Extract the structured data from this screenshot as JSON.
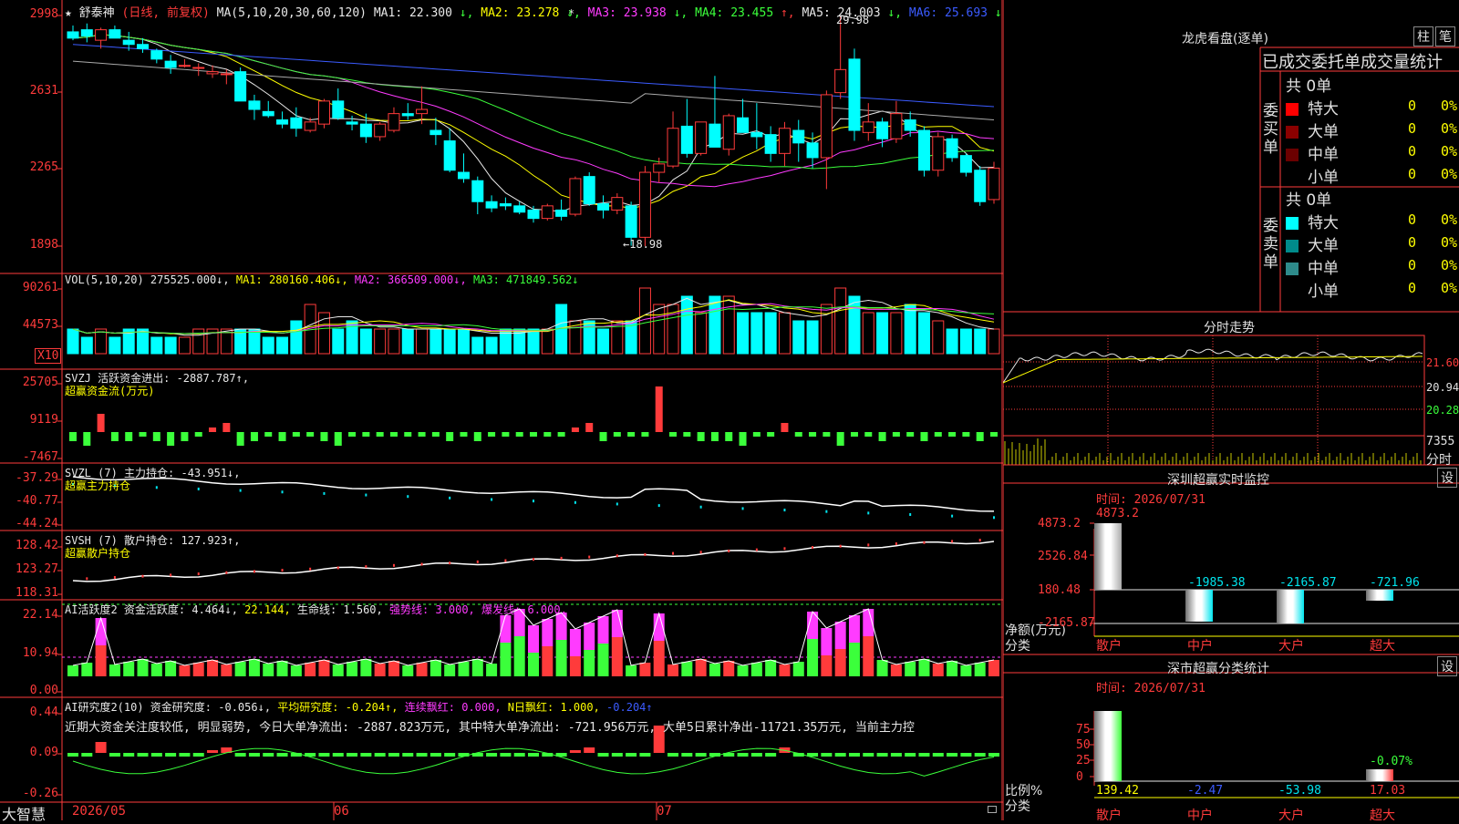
{
  "stock": {
    "star": "★",
    "name": "舒泰神",
    "mode": "(日线, 前复权)"
  },
  "ma_header": {
    "params": "MA(5,10,20,30,60,120)",
    "items": [
      {
        "label": "MA1:",
        "value": "22.300",
        "arrow": "↓",
        "color": "#e8e8e8"
      },
      {
        "label": "MA2:",
        "value": "23.278",
        "arrow": "↓",
        "color": "#ffff00"
      },
      {
        "label": "MA3:",
        "value": "23.938",
        "arrow": "↓",
        "color": "#ff3bff"
      },
      {
        "label": "MA4:",
        "value": "23.455",
        "arrow": "↑",
        "color": "#3bff3b"
      },
      {
        "label": "MA5:",
        "value": "24.003",
        "arrow": "↓",
        "color": "#e8e8e8"
      },
      {
        "label": "MA6:",
        "value": "25.693",
        "arrow": "↓",
        "color": "#3b5bff"
      }
    ],
    "high_label": "29.98",
    "low_label": "←18.98"
  },
  "price_axis": [
    "2998",
    "2631",
    "2265",
    "1898"
  ],
  "vol": {
    "header": [
      {
        "text": "VOL(5,10,20)",
        "color": "#e8e8e8"
      },
      {
        "text": "275525.000↓,",
        "color": "#e8e8e8"
      },
      {
        "text": "MA1: 280160.406↓,",
        "color": "#ffff00"
      },
      {
        "text": "MA2: 366509.000↓,",
        "color": "#ff3bff"
      },
      {
        "text": "MA3: 471849.562↓",
        "color": "#3bff3b"
      }
    ],
    "axis": [
      "90261",
      "44573"
    ],
    "unit": "X10"
  },
  "svzj": {
    "line1": "SVZJ  活跃资金进出: -2887.787↑,",
    "line2": "超赢资金流(万元)",
    "axis": [
      "25705",
      "9119",
      "-7467"
    ]
  },
  "svzl": {
    "line1": "SVZL (7) 主力持仓: -43.951↓,",
    "line2": "超赢主力持仓",
    "axis": [
      "-37.29",
      "-40.77",
      "-44.24"
    ]
  },
  "svsh": {
    "line1": "SVSH (7) 散户持仓: 127.923↑,",
    "line2": "超赢散户持仓",
    "axis": [
      "128.42",
      "123.27",
      "118.31"
    ]
  },
  "ai_active": {
    "header": [
      {
        "text": "AI活跃度2 资金活跃度: 4.464↓,",
        "color": "#e8e8e8"
      },
      {
        "text": "22.144,",
        "color": "#ffff00"
      },
      {
        "text": "生命线: 1.560,",
        "color": "#e8e8e8"
      },
      {
        "text": "强势线: 3.000,",
        "color": "#ff3bff"
      },
      {
        "text": "爆发线: 6.000,",
        "color": "#ff3bff"
      }
    ],
    "axis": [
      "22.14",
      "10.94",
      "0.00"
    ]
  },
  "ai_research": {
    "header": [
      {
        "text": "AI研究度2(10) 资金研究度: -0.056↓,",
        "color": "#e8e8e8"
      },
      {
        "text": "平均研究度: -0.204↑,",
        "color": "#ffff00"
      },
      {
        "text": "连续飘红: 0.000,",
        "color": "#ff3bff"
      },
      {
        "text": "N日飘红: 1.000,",
        "color": "#ffff00"
      },
      {
        "text": "-0.204↑",
        "color": "#3b5bff"
      }
    ],
    "comment": "近期大资金关注度较低, 明显弱势, 今日大单净流出: -2887.823万元, 其中特大单净流出: -721.956万元, 大单5日累计净出-11721.35万元, 当前主力控",
    "axis": [
      "0.44",
      "0.09",
      "-0.26"
    ]
  },
  "date_axis": {
    "logo": "大智慧",
    "labels": [
      "2026/05",
      "06",
      "07"
    ]
  },
  "right": {
    "lhb_title": "龙虎看盘(逐单)",
    "btn_bar": "柱",
    "btn_stroke": "笔",
    "stats_header": "已成交委托单成交量统计",
    "buy": {
      "vertical": "委买单",
      "total": "共 0单",
      "rows": [
        {
          "label": "特大",
          "value": "0",
          "pct": "0%",
          "color": "#ff0000"
        },
        {
          "label": "大单",
          "value": "0",
          "pct": "0%",
          "color": "#8b0000"
        },
        {
          "label": "中单",
          "value": "0",
          "pct": "0%",
          "color": "#6b0000"
        },
        {
          "label": "小单",
          "value": "0",
          "pct": "0%",
          "color": "#000000"
        }
      ]
    },
    "sell": {
      "vertical": "委卖单",
      "total": "共 0单",
      "rows": [
        {
          "label": "特大",
          "value": "0",
          "pct": "0%",
          "color": "#00ffff"
        },
        {
          "label": "大单",
          "value": "0",
          "pct": "0%",
          "color": "#008b8b"
        },
        {
          "label": "中单",
          "value": "0",
          "pct": "0%",
          "color": "#2e8b8b"
        },
        {
          "label": "小单",
          "value": "0",
          "pct": "0%",
          "color": "#000000"
        }
      ]
    },
    "intraday": {
      "title": "分时走势",
      "axis": [
        "21.60",
        "20.94",
        "20.28"
      ],
      "vol_axis": [
        "7355",
        "分时"
      ]
    },
    "monitor": {
      "title": "深圳超赢实时监控",
      "btn": "设",
      "time": "时间: 2026/07/31",
      "axis": [
        "4873.2",
        "2526.84",
        "180.48",
        "-2165.87"
      ],
      "bar_labels": [
        "4873.2",
        "-1985.38",
        "-2165.87",
        "-721.96"
      ],
      "ylabel": "净额(万元)",
      "xlabel": "分类",
      "cats": [
        "散户",
        "中户",
        "大户",
        "超大"
      ]
    },
    "category": {
      "title": "深市超赢分类统计",
      "btn": "设",
      "time": "时间: 2026/07/31",
      "axis": [
        "75",
        "50",
        "25",
        "0"
      ],
      "pct_label": "-0.07%",
      "values": [
        "139.42",
        "-2.47",
        "-53.98",
        "17.03"
      ],
      "ylabel": "比例%",
      "xlabel": "分类",
      "cats": [
        "散户",
        "中户",
        "大户",
        "超大"
      ]
    }
  },
  "candles": [
    [
      29.2,
      29.5,
      28.8,
      28.9
    ],
    [
      29.3,
      29.6,
      28.7,
      29.0
    ],
    [
      28.8,
      29.4,
      28.4,
      29.3
    ],
    [
      29.3,
      29.5,
      28.9,
      28.9
    ],
    [
      28.8,
      29.2,
      28.3,
      28.6
    ],
    [
      28.6,
      28.9,
      28.2,
      28.4
    ],
    [
      28.3,
      28.4,
      27.7,
      27.9
    ],
    [
      27.8,
      28.1,
      27.2,
      27.5
    ],
    [
      27.6,
      27.9,
      27.5,
      27.6
    ],
    [
      27.5,
      27.7,
      27.1,
      27.5
    ],
    [
      27.2,
      27.6,
      27.0,
      27.3
    ],
    [
      27.2,
      27.4,
      26.7,
      27.2
    ],
    [
      27.3,
      27.5,
      26.1,
      25.9
    ],
    [
      25.9,
      26.2,
      25.0,
      25.5
    ],
    [
      25.4,
      25.9,
      25.1,
      25.2
    ],
    [
      25.0,
      25.4,
      24.6,
      24.8
    ],
    [
      25.1,
      25.6,
      24.2,
      24.6
    ],
    [
      24.5,
      25.1,
      24.4,
      24.9
    ],
    [
      24.8,
      26.0,
      24.6,
      25.9
    ],
    [
      25.9,
      26.5,
      25.0,
      25.1
    ],
    [
      24.9,
      25.2,
      24.5,
      24.8
    ],
    [
      24.8,
      25.3,
      23.9,
      24.2
    ],
    [
      24.2,
      24.9,
      24.0,
      24.8
    ],
    [
      24.5,
      25.6,
      24.4,
      25.3
    ],
    [
      25.3,
      25.8,
      25.0,
      25.2
    ],
    [
      25.3,
      26.6,
      24.8,
      25.5
    ],
    [
      24.5,
      25.1,
      23.8,
      24.3
    ],
    [
      24.0,
      24.6,
      22.5,
      22.6
    ],
    [
      22.5,
      23.4,
      22.0,
      22.2
    ],
    [
      22.1,
      22.3,
      20.5,
      21.1
    ],
    [
      21.1,
      21.4,
      20.6,
      20.8
    ],
    [
      21.0,
      21.3,
      20.7,
      20.9
    ],
    [
      20.9,
      21.1,
      20.5,
      20.6
    ],
    [
      20.7,
      20.9,
      20.1,
      20.3
    ],
    [
      20.3,
      21.0,
      20.2,
      20.9
    ],
    [
      20.7,
      21.2,
      20.2,
      20.4
    ],
    [
      20.5,
      22.3,
      20.4,
      22.2
    ],
    [
      22.3,
      22.5,
      20.9,
      21.0
    ],
    [
      21.0,
      21.4,
      20.3,
      20.7
    ],
    [
      20.7,
      21.5,
      20.5,
      21.3
    ],
    [
      20.9,
      21.1,
      19.0,
      19.4
    ],
    [
      19.4,
      22.8,
      18.98,
      22.5
    ],
    [
      22.5,
      23.2,
      22.0,
      22.9
    ],
    [
      22.8,
      25.4,
      22.7,
      24.6
    ],
    [
      24.7,
      26.0,
      23.2,
      23.4
    ],
    [
      23.4,
      24.8,
      23.3,
      24.9
    ],
    [
      24.8,
      27.1,
      23.7,
      23.7
    ],
    [
      23.6,
      25.3,
      23.3,
      25.2
    ],
    [
      25.1,
      26.0,
      24.4,
      24.4
    ],
    [
      24.4,
      25.8,
      23.6,
      24.2
    ],
    [
      24.3,
      24.7,
      23.0,
      23.4
    ],
    [
      23.4,
      24.9,
      22.8,
      24.6
    ],
    [
      24.5,
      25.0,
      23.0,
      23.9
    ],
    [
      23.9,
      24.4,
      22.7,
      23.2
    ],
    [
      23.2,
      26.4,
      21.7,
      26.2
    ],
    [
      26.3,
      29.98,
      26.0,
      27.4
    ],
    [
      27.9,
      28.4,
      24.0,
      24.5
    ],
    [
      24.4,
      25.8,
      24.0,
      24.9
    ],
    [
      24.9,
      25.1,
      23.7,
      24.1
    ],
    [
      24.1,
      25.9,
      23.9,
      25.3
    ],
    [
      25.0,
      25.4,
      24.2,
      24.5
    ],
    [
      24.5,
      24.7,
      22.3,
      22.6
    ],
    [
      22.6,
      24.4,
      22.3,
      24.2
    ],
    [
      24.1,
      24.3,
      23.0,
      23.2
    ],
    [
      23.3,
      23.4,
      22.3,
      22.5
    ],
    [
      22.6,
      22.8,
      20.9,
      21.1
    ],
    [
      21.2,
      23.0,
      21.0,
      22.7
    ]
  ],
  "vol_bars": [
    3,
    2,
    3,
    2,
    3,
    3,
    2,
    2,
    2,
    3,
    3,
    3,
    3,
    3,
    2,
    2,
    4,
    6,
    5,
    3,
    4,
    3,
    3,
    3,
    3,
    3,
    3,
    3,
    3,
    2,
    2,
    3,
    3,
    3,
    3,
    6,
    4,
    4,
    3,
    4,
    4,
    8,
    6,
    6,
    7,
    5,
    7,
    7,
    5,
    5,
    5,
    5,
    4,
    4,
    6,
    8,
    7,
    5,
    5,
    5,
    6,
    5,
    4,
    3,
    3,
    3,
    3
  ],
  "svzj_bars": [
    -2,
    -3,
    4,
    -2,
    -2,
    -1,
    -2,
    -3,
    -2,
    -1,
    1,
    2,
    -3,
    -2,
    -1,
    -2,
    -1,
    -1,
    -2,
    -3,
    -1,
    -1,
    -1,
    -1,
    -1,
    -1,
    -1,
    -2,
    -1,
    -2,
    -1,
    -1,
    -1,
    -1,
    -1,
    -1,
    1,
    2,
    -2,
    -1,
    -1,
    -1,
    10,
    -1,
    -1,
    -2,
    -2,
    -2,
    -3,
    -1,
    -1,
    2,
    -1,
    -1,
    -1,
    -3,
    -1,
    -1,
    -2,
    -1,
    -1,
    -2,
    -1,
    -1,
    -1,
    -2,
    -1,
    -1,
    -1,
    -1
  ]
}
